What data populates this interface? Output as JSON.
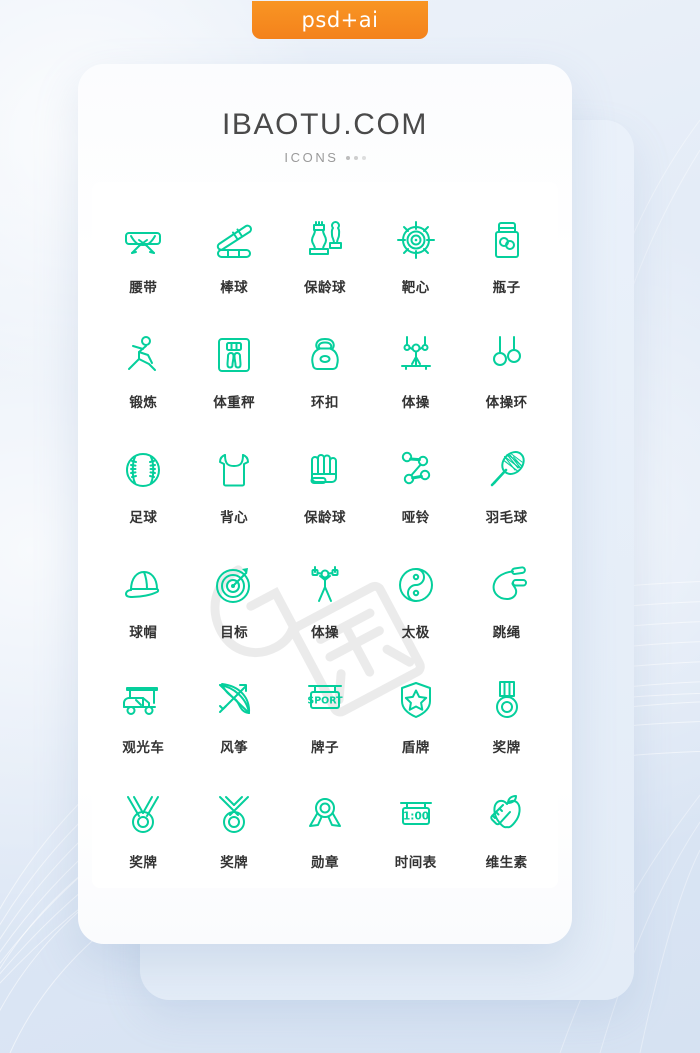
{
  "badge": {
    "label": "psd+ai",
    "color": "#f4821c"
  },
  "card": {
    "title": "IBAOTU.COM",
    "subtitle": "ICONS",
    "accent_color": "#05cf9c",
    "label_color": "#333333",
    "title_color": "#4a4a4a",
    "subtitle_color": "#9a9a9a"
  },
  "watermark": {
    "text": "包图网"
  },
  "icons": [
    {
      "label": "腰带",
      "icon": "belt-icon"
    },
    {
      "label": "棒球",
      "icon": "baseball-bat-icon"
    },
    {
      "label": "保龄球",
      "icon": "bowling-pins-icon"
    },
    {
      "label": "靶心",
      "icon": "bullseye-icon"
    },
    {
      "label": "瓶子",
      "icon": "supplement-bottle-icon"
    },
    {
      "label": "锻炼",
      "icon": "stretching-person-icon"
    },
    {
      "label": "体重秤",
      "icon": "weight-scale-icon"
    },
    {
      "label": "环扣",
      "icon": "kettlebell-icon"
    },
    {
      "label": "体操",
      "icon": "gymnast-rings-icon"
    },
    {
      "label": "体操环",
      "icon": "gymnastic-rings-icon"
    },
    {
      "label": "足球",
      "icon": "baseball-icon"
    },
    {
      "label": "背心",
      "icon": "tank-top-icon"
    },
    {
      "label": "保龄球",
      "icon": "fist-icon"
    },
    {
      "label": "哑铃",
      "icon": "dumbbells-icon"
    },
    {
      "label": "羽毛球",
      "icon": "racket-icon"
    },
    {
      "label": "球帽",
      "icon": "cap-icon"
    },
    {
      "label": "目标",
      "icon": "target-dart-icon"
    },
    {
      "label": "体操",
      "icon": "weightlifter-icon"
    },
    {
      "label": "太极",
      "icon": "yin-yang-icon"
    },
    {
      "label": "跳绳",
      "icon": "jump-rope-icon"
    },
    {
      "label": "观光车",
      "icon": "golf-cart-icon"
    },
    {
      "label": "风筝",
      "icon": "bow-arrow-icon"
    },
    {
      "label": "牌子",
      "icon": "sport-sign-icon"
    },
    {
      "label": "盾牌",
      "icon": "shield-star-icon"
    },
    {
      "label": "奖牌",
      "icon": "medal-ribbon-icon"
    },
    {
      "label": "奖牌",
      "icon": "medal-vneck-icon"
    },
    {
      "label": "奖牌",
      "icon": "medal-crossed-icon"
    },
    {
      "label": "勋章",
      "icon": "badge-rosette-icon"
    },
    {
      "label": "时间表",
      "icon": "timer-sign-icon"
    },
    {
      "label": "维生素",
      "icon": "apple-tape-icon"
    }
  ],
  "sign_texts": {
    "sport": "SPORT",
    "time": "1:00"
  }
}
